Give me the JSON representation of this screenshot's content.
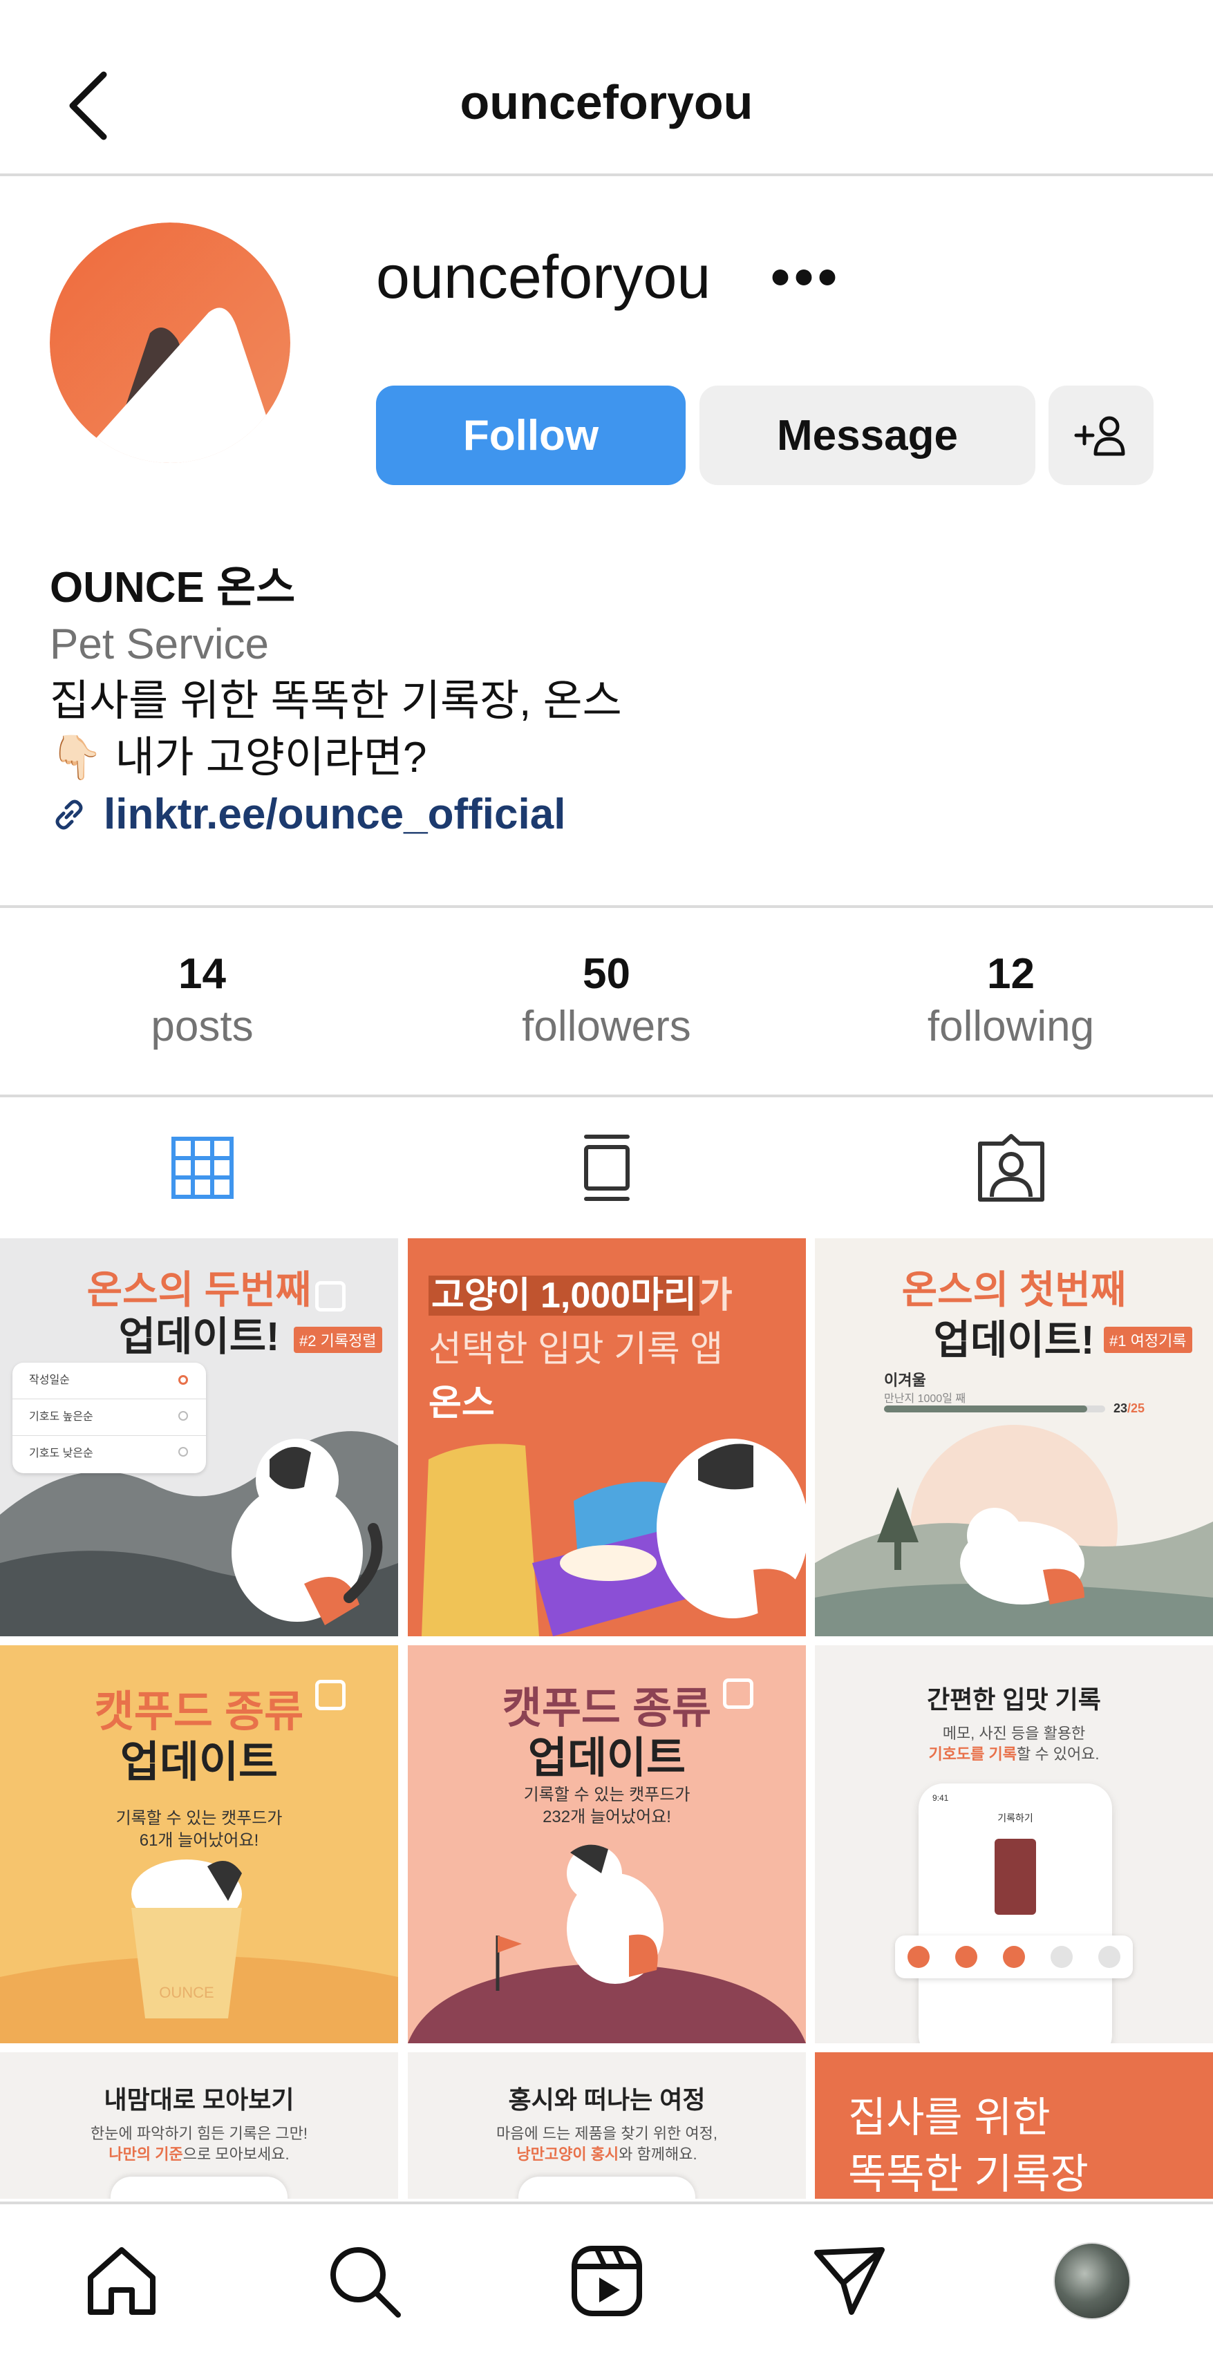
{
  "header": {
    "title": "ounceforyou"
  },
  "profile": {
    "handle": "ounceforyou",
    "follow_label": "Follow",
    "message_label": "Message"
  },
  "bio": {
    "name": "OUNCE 온스",
    "category": "Pet Service",
    "line1": "집사를 위한 똑똑한 기록장, 온스",
    "line2_emoji": "👇🏻",
    "line2": "내가 고양이라면?",
    "link": "linktr.ee/ounce_official"
  },
  "stats": [
    {
      "value": "14",
      "label": "posts"
    },
    {
      "value": "50",
      "label": "followers"
    },
    {
      "value": "12",
      "label": "following"
    }
  ],
  "tabs": [
    "grid-icon",
    "reels-feed-icon",
    "tagged-icon"
  ],
  "accent_color": "#3f95ee",
  "brand_color": "#e8714a",
  "posts": [
    {
      "title1": "온스의 두번째",
      "title2": "업데이트!",
      "tag": "#2 기록정렬",
      "items": [
        "작성일순",
        "기호도 높은순",
        "기호도 낮은순"
      ]
    },
    {
      "line1a": "고양이 1,000마리",
      "line1b": "가",
      "line2": "선택한 입맛 기록 앱",
      "line3": "온스"
    },
    {
      "title1": "온스의 첫번째",
      "title2": "업데이트!",
      "tag": "#1 여정기록",
      "name": "이겨울",
      "sub": "만난지 1000일 째",
      "count_done": "23",
      "count_total": "/25"
    },
    {
      "title1": "캣푸드 종류",
      "title2": "업데이트",
      "sub1": "기록할 수 있는 캣푸드가",
      "sub2": "61개 늘어났어요!",
      "box": "OUNCE"
    },
    {
      "title1": "캣푸드 종류",
      "title2": "업데이트",
      "sub1": "기록할 수 있는 캣푸드가",
      "sub2": "232개 늘어났어요!"
    },
    {
      "title": "간편한 입맛 기록",
      "sub1": "메모, 사진 등을 활용한",
      "sub2a": "기호도를 기록",
      "sub2b": "할 수 있어요.",
      "phone_time": "9:41",
      "phone_title": "기록하기"
    },
    {
      "title": "내맘대로 모아보기",
      "sub1": "한눈에 파악하기 힘든 기록은 그만!",
      "sub2a": "나만의 기준",
      "sub2b": "으로 모아보세요."
    },
    {
      "title": "홍시와 떠나는 여정",
      "sub1": "마음에 드는 제품을 찾기 위한 여정,",
      "sub2a": "낭만고양이 홍시",
      "sub2b": "와 함께해요."
    },
    {
      "line1": "집사를 위한",
      "line2": "똑똑한 기록장"
    }
  ]
}
